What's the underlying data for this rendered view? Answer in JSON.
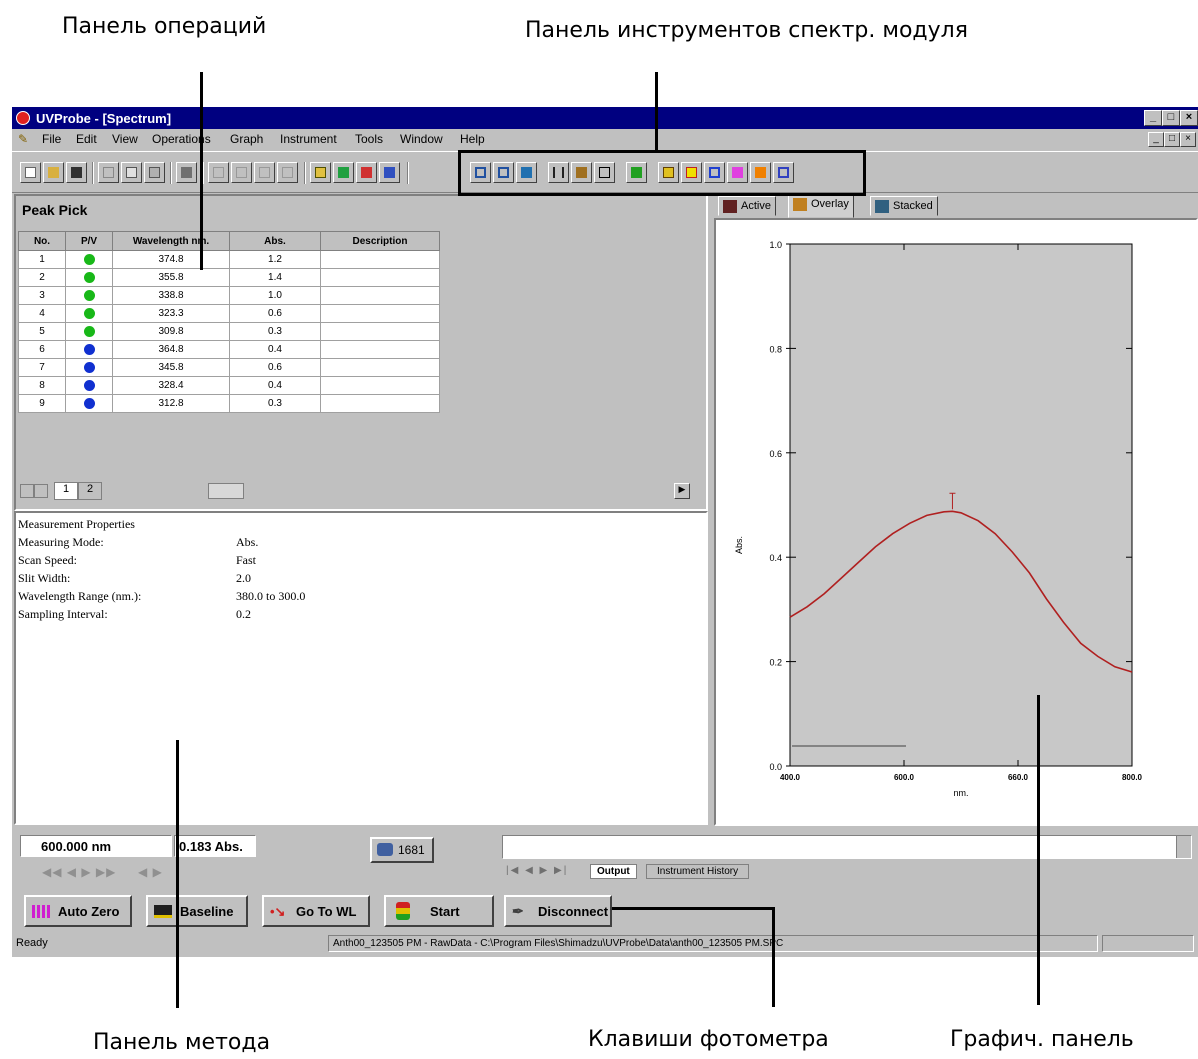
{
  "annotations": {
    "operations_panel": "Панель операций",
    "spectrum_toolbar": "Панель инструментов спектр. модуля",
    "method_panel": "Панель метода",
    "photometer_keys": "Клавиши фотометра",
    "graph_panel": "Графич. панель"
  },
  "window": {
    "title": "UVProbe - [Spectrum]",
    "controls": [
      "_",
      "□",
      "×"
    ]
  },
  "menu": {
    "items": [
      "File",
      "Edit",
      "View",
      "Operations",
      "Graph",
      "Instrument",
      "Tools",
      "Window",
      "Help"
    ]
  },
  "peak_pick": {
    "title": "Peak Pick",
    "columns": [
      "No.",
      "P/V",
      "Wavelength nm.",
      "Abs.",
      "Description"
    ],
    "rows": [
      {
        "no": "1",
        "type": "peak",
        "wl": "374.8",
        "abs": "1.2",
        "desc": ""
      },
      {
        "no": "2",
        "type": "peak",
        "wl": "355.8",
        "abs": "1.4",
        "desc": ""
      },
      {
        "no": "3",
        "type": "peak",
        "wl": "338.8",
        "abs": "1.0",
        "desc": ""
      },
      {
        "no": "4",
        "type": "peak",
        "wl": "323.3",
        "abs": "0.6",
        "desc": ""
      },
      {
        "no": "5",
        "type": "peak",
        "wl": "309.8",
        "abs": "0.3",
        "desc": ""
      },
      {
        "no": "6",
        "type": "valley",
        "wl": "364.8",
        "abs": "0.4",
        "desc": ""
      },
      {
        "no": "7",
        "type": "valley",
        "wl": "345.8",
        "abs": "0.6",
        "desc": ""
      },
      {
        "no": "8",
        "type": "valley",
        "wl": "328.4",
        "abs": "0.4",
        "desc": ""
      },
      {
        "no": "9",
        "type": "valley",
        "wl": "312.8",
        "abs": "0.3",
        "desc": ""
      }
    ],
    "peak_color": "#18b818",
    "valley_color": "#1030d0",
    "sheet_tabs": [
      "1",
      "2"
    ]
  },
  "method": {
    "heading": "Measurement Properties",
    "properties": [
      {
        "label": "Measuring Mode:",
        "value": "Abs."
      },
      {
        "label": "Scan Speed:",
        "value": "Fast"
      },
      {
        "label": "Slit Width:",
        "value": "2.0"
      },
      {
        "label": "Wavelength Range (nm.):",
        "value": "380.0 to 300.0"
      },
      {
        "label": "Sampling Interval:",
        "value": "0.2"
      }
    ]
  },
  "graph": {
    "tabs": [
      "Active",
      "Overlay",
      "Stacked"
    ],
    "chart_data": {
      "type": "line",
      "xlabel": "nm.",
      "ylabel": "Abs.",
      "xlim": [
        400,
        800
      ],
      "ylim": [
        0,
        1.0
      ],
      "xticks": [
        "400.0",
        "600.0",
        "660.0",
        "800.0"
      ],
      "yticks": [
        "0.0",
        "0.2",
        "0.4",
        "0.6",
        "0.8",
        "1.0"
      ],
      "series": [
        {
          "color": "#b02020",
          "x": [
            400,
            420,
            440,
            460,
            480,
            500,
            520,
            540,
            560,
            580,
            590,
            600,
            620,
            640,
            660,
            680,
            700,
            720,
            740,
            760,
            780,
            800
          ],
          "y": [
            0.285,
            0.305,
            0.33,
            0.36,
            0.39,
            0.42,
            0.445,
            0.465,
            0.48,
            0.487,
            0.488,
            0.485,
            0.47,
            0.445,
            0.41,
            0.37,
            0.32,
            0.275,
            0.235,
            0.21,
            0.19,
            0.18
          ]
        }
      ],
      "peak_marker": {
        "x": 590,
        "y": 0.488
      },
      "grid": false
    }
  },
  "status": {
    "wavelength": "600.000 nm",
    "abs_value": "0.183 Abs.",
    "counter": "1681",
    "output_tabs": [
      "Output",
      "Instrument History"
    ]
  },
  "photometer": {
    "buttons": [
      {
        "label": "Auto Zero",
        "icon": "autozero-icon"
      },
      {
        "label": "Baseline",
        "icon": "baseline-icon"
      },
      {
        "label": "Go To WL",
        "icon": "goto-wl-icon"
      },
      {
        "label": "Start",
        "icon": "start-icon"
      },
      {
        "label": "Disconnect",
        "icon": "disconnect-icon"
      }
    ]
  },
  "statusbar": {
    "state": "Ready",
    "file": "Anth00_123505 PM - RawData - C:\\Program Files\\Shimadzu\\UVProbe\\Data\\anth00_123505 PM.SPC"
  }
}
